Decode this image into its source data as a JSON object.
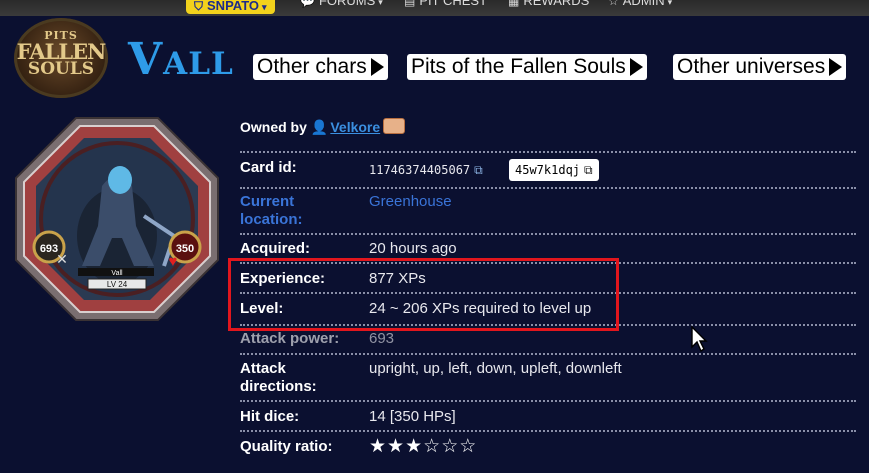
{
  "nav": {
    "items": [
      {
        "label": "SNPATO",
        "icon": "shield-icon",
        "caret": "▾"
      },
      {
        "label": "FORUMS",
        "icon": "chat-icon",
        "caret": "▾"
      },
      {
        "label": "PIT CHEST",
        "icon": "chest-icon"
      },
      {
        "label": "REWARDS",
        "icon": "gift-icon"
      },
      {
        "label": "ADMIN",
        "icon": "star-icon",
        "caret": "▾"
      }
    ]
  },
  "logo": {
    "line1": "PITS",
    "line2": "FALLEN",
    "line3": "SOULS"
  },
  "character": {
    "name": "Vall"
  },
  "tabs": [
    {
      "label": "Other chars"
    },
    {
      "label": "Pits of the Fallen Souls"
    },
    {
      "label": "Other universes"
    }
  ],
  "card": {
    "name": "Vall",
    "level": "LV 24",
    "attack": "693",
    "hp": "350"
  },
  "owner": {
    "prefix": "Owned by",
    "name": "Velkore"
  },
  "details": {
    "card_id": {
      "label": "Card id:",
      "value": "11746374405067",
      "code": "45w7k1dqj"
    },
    "location": {
      "label": "Current location:",
      "value": "Greenhouse"
    },
    "acquired": {
      "label": "Acquired:",
      "value": "20 hours ago"
    },
    "experience": {
      "label": "Experience:",
      "value": "877 XPs"
    },
    "level": {
      "label": "Level:",
      "value": "24 ~ 206 XPs required to level up"
    },
    "attack_power": {
      "label": "Attack power:",
      "value": "693"
    },
    "attack_directions": {
      "label": "Attack directions:",
      "value": "upright, up, left, down, upleft, downleft"
    },
    "hit_dice": {
      "label": "Hit dice:",
      "value": "14 [350 HPs]"
    },
    "quality": {
      "label": "Quality ratio:",
      "stars_filled": 3,
      "stars_total": 6
    }
  },
  "colors": {
    "accent": "#2e9be8",
    "link": "#3b8fe0",
    "highlight": "#e2161d",
    "background": "#0b1030"
  }
}
